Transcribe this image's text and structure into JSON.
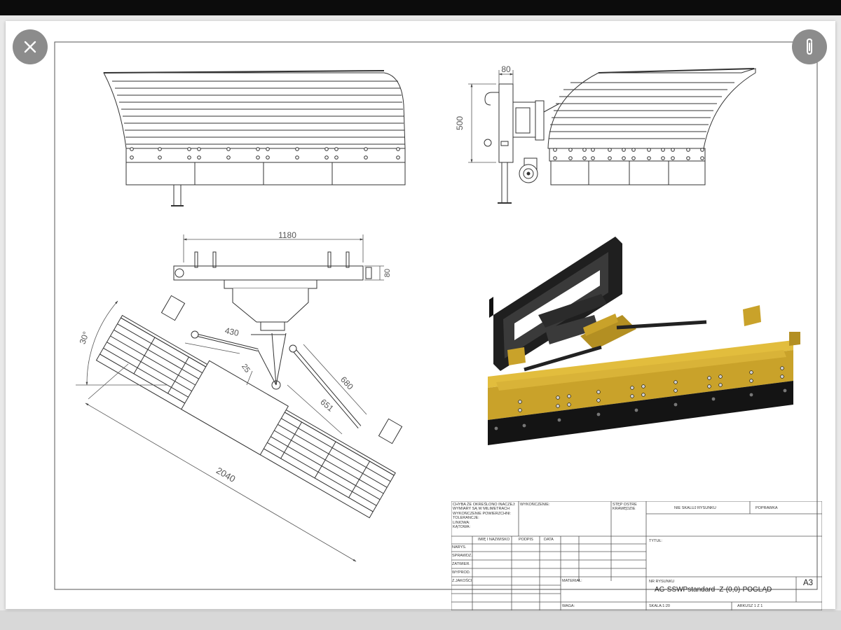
{
  "viewer": {
    "close_icon": "close-icon",
    "attach_icon": "paperclip-icon"
  },
  "drawing": {
    "dimensions": {
      "side_width": "80",
      "side_height": "500",
      "top_width": "1180",
      "top_depth": "80",
      "arm_length": "430",
      "pivot_offset": "25",
      "cylinder_long": "680",
      "cylinder_short": "651",
      "blade_width": "2040",
      "angle": "30°"
    },
    "colors": {
      "frame_dark": "#1f1f1f",
      "blade_yellow": "#c9a22a",
      "blade_yellow_light": "#e2bd3d",
      "rubber_edge": "#141414"
    }
  },
  "title_block": {
    "notes": "CHYBA ŻE OKREŚLONO INACZEJ:\nWYMIARY SĄ W MILIMETRACH\nWYKOŃCZENIE POWIERZCHNI:\nTOLERANCJE:\n   LINIOWA:\n   KĄTOWA:",
    "finish_label": "WYKOŃCZENIE:",
    "deburr_label": "STĘP OSTRE\nKRAWĘDZIE",
    "no_scale_label": "NIE SKALUJ RYSUNKU",
    "revision_label": "POPRAWKA",
    "col_name": "IMIĘ I NAZWISKO",
    "col_signature": "PODPIS",
    "col_date": "DATA",
    "rows": [
      "NARYS.",
      "SPRAWDZ.",
      "ZATWIER.",
      "WYPROD.",
      "Z.JAKOŚCI"
    ],
    "title_label": "TYTUŁ:",
    "material_label": "MATERIAŁ:",
    "drawing_no_label": "NR RYSUNKU",
    "drawing_no": "AG-SSWPstandard -Z-(0,0)-POGLĄD",
    "sheet_size": "A3",
    "weight_label": "WAGA:",
    "scale_label": "SKALA:1:20",
    "sheet_label": "ARKUSZ 1 Z 1"
  }
}
